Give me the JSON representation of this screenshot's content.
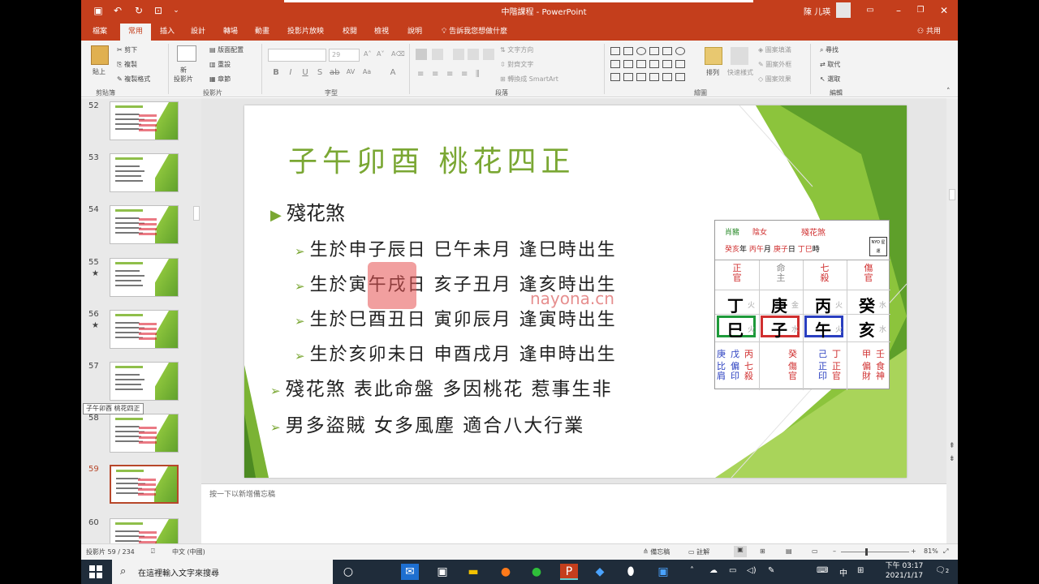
{
  "window": {
    "title": "中階課程 - PowerPoint",
    "user": "陳 儿瑛"
  },
  "quick_access": {
    "save": "save-icon",
    "undo": "undo-icon",
    "redo": "redo-icon"
  },
  "tabs": [
    "檔案",
    "常用",
    "插入",
    "設計",
    "轉場",
    "動畫",
    "投影片放映",
    "校閱",
    "檢視",
    "說明",
    "告訴我您想做什麼"
  ],
  "share_label": "共用",
  "ribbon": {
    "clipboard": {
      "paste": "貼上",
      "cut": "剪下",
      "copy": "複製",
      "format_painter": "複製格式",
      "label": "剪貼簿"
    },
    "slides": {
      "new_slide": "新\n投影片",
      "layout": "版面配置",
      "reset": "重設",
      "section": "章節",
      "label": "投影片"
    },
    "font": {
      "size": "29",
      "label": "字型"
    },
    "paragraph": {
      "direction": "文字方向",
      "align": "對齊文字",
      "smartart": "轉換成 SmartArt",
      "label": "段落"
    },
    "drawing": {
      "arrange": "排列",
      "quick_styles": "快速樣式",
      "fill": "圖案填滿",
      "outline": "圖案外框",
      "effects": "圖案效果",
      "label": "繪圖"
    },
    "editing": {
      "find": "尋找",
      "replace": "取代",
      "select": "選取",
      "label": "編輯"
    }
  },
  "thumbnails": [
    {
      "num": "52",
      "star": ""
    },
    {
      "num": "53",
      "star": ""
    },
    {
      "num": "54",
      "star": ""
    },
    {
      "num": "55",
      "star": "★"
    },
    {
      "num": "56",
      "star": "★"
    },
    {
      "num": "57",
      "star": ""
    },
    {
      "num": "58",
      "star": ""
    },
    {
      "num": "59",
      "star": "",
      "selected": true
    },
    {
      "num": "60",
      "star": ""
    }
  ],
  "thumb_tooltip": "子午卯酉 桃花四正",
  "slide": {
    "title": "子午卯酉  桃花四正",
    "bullet_main": "殘花煞",
    "sub_bullets": [
      "生於申子辰日  巳午未月    逢巳時出生",
      "生於寅午戌日  亥子丑月    逢亥時出生",
      "生於巳酉丑日  寅卯辰月    逢寅時出生",
      "生於亥卯未日  申酉戌月    逢申時出生"
    ],
    "bullet_2": "殘花煞  表此命盤  多因桃花  惹事生非",
    "bullet_3": "男多盜賊  女多風塵  適合八大行業",
    "watermark": "nayona.cn",
    "chart": {
      "zodiac": "肖豬",
      "gender": "陰女",
      "sha_name": "殘花煞",
      "row2": [
        "癸亥",
        "年",
        "丙午",
        "月",
        "庚子",
        "日",
        "丁巳",
        "時"
      ],
      "logo": "NYO 星運",
      "gods": [
        "正\n官",
        "命\n主",
        "七\n殺",
        "傷\n官"
      ],
      "stems": [
        "丁",
        "庚",
        "丙",
        "癸"
      ],
      "stem_elems": [
        "火",
        "金",
        "火",
        "水"
      ],
      "branches": [
        "巳",
        "子",
        "午",
        "亥"
      ],
      "branch_elems": [
        "火",
        "水",
        "火",
        "水"
      ],
      "hidden_stems": [
        [
          [
            "庚",
            "#2a3fc0"
          ],
          [
            "戊",
            "#2a3fc0"
          ],
          [
            "丙",
            "#d03030"
          ]
        ],
        [
          [
            "",
            ""
          ],
          [
            "",
            ""
          ],
          [
            "癸",
            "#d03030"
          ]
        ],
        [
          [
            "",
            ""
          ],
          [
            "己",
            "#2a3fc0"
          ],
          [
            "丁",
            "#d03030"
          ]
        ],
        [
          [
            "",
            ""
          ],
          [
            "甲",
            "#d03030"
          ],
          [
            "壬",
            "#d03030"
          ]
        ]
      ],
      "hidden_gods": [
        [
          "比\n肩",
          "偏\n印",
          "七\n殺"
        ],
        [
          "",
          "",
          "傷\n官"
        ],
        [
          "",
          "正\n印",
          "正\n官"
        ],
        [
          "",
          "偏\n財",
          "食\n神"
        ]
      ]
    }
  },
  "notes_placeholder": "按一下以新增備忘稿",
  "status": {
    "slide_count": "投影片 59 / 234",
    "lang": "中文 (中國)",
    "notes": "備忘稿",
    "comments": "註解",
    "zoom": "81%"
  },
  "taskbar": {
    "search_placeholder": "在這裡輸入文字來搜尋",
    "ime": "中",
    "time": "下午 03:17",
    "date": "2021/1/17",
    "notif": "2"
  },
  "colors": {
    "accent": "#c43e1c",
    "green": "#7aa733",
    "red": "#d03030",
    "blue": "#2a3fc0"
  }
}
